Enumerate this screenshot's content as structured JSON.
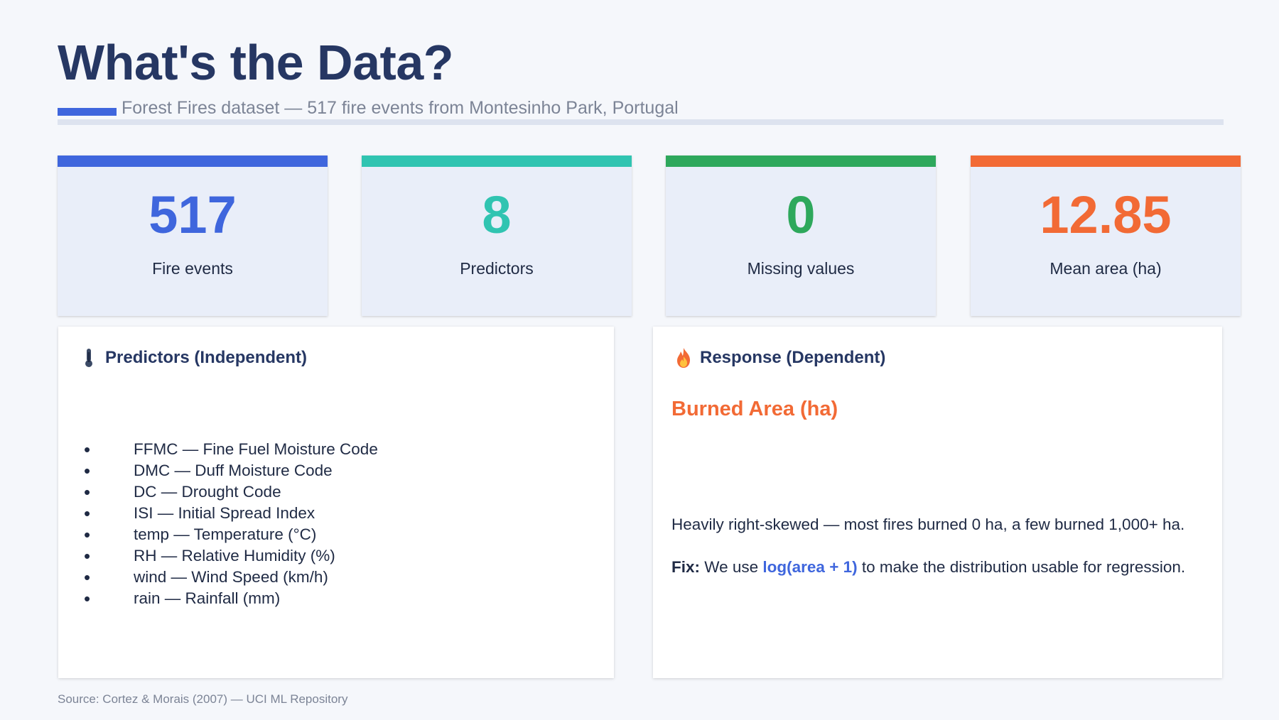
{
  "header": {
    "title": "What's the Data?",
    "subtitle": "Forest Fires dataset — 517 fire events from Montesinho Park, Portugal"
  },
  "stats": [
    {
      "value": "517",
      "label": "Fire events",
      "color": "#3f66dd"
    },
    {
      "value": "8",
      "label": "Predictors",
      "color": "#30c4b1"
    },
    {
      "value": "0",
      "label": "Missing values",
      "color": "#2ea85c"
    },
    {
      "value": "12.85",
      "label": "Mean area (ha)",
      "color": "#f26a35"
    }
  ],
  "predictors": {
    "icon": "thermometer-icon",
    "title": "Predictors (Independent)",
    "items": [
      "FFMC — Fine Fuel Moisture Code",
      "DMC  — Duff Moisture Code",
      "DC   — Drought Code",
      "ISI  — Initial Spread Index",
      "temp — Temperature (°C)",
      "RH   — Relative Humidity (%)",
      "wind — Wind Speed (km/h)",
      "rain — Rainfall (mm)"
    ]
  },
  "response": {
    "icon": "fire-icon",
    "title": "Response (Dependent)",
    "heading": "Burned Area (ha)",
    "description": "Heavily right-skewed — most fires burned 0 ha, a few burned 1,000+ ha.",
    "fix_label": "Fix:",
    "fix_pre": "We use",
    "fix_code": "log(area + 1)",
    "fix_post": "to make the distribution usable for regression."
  },
  "footer": {
    "source": "Source: Cortez & Morais (2007) — UCI ML Repository"
  }
}
